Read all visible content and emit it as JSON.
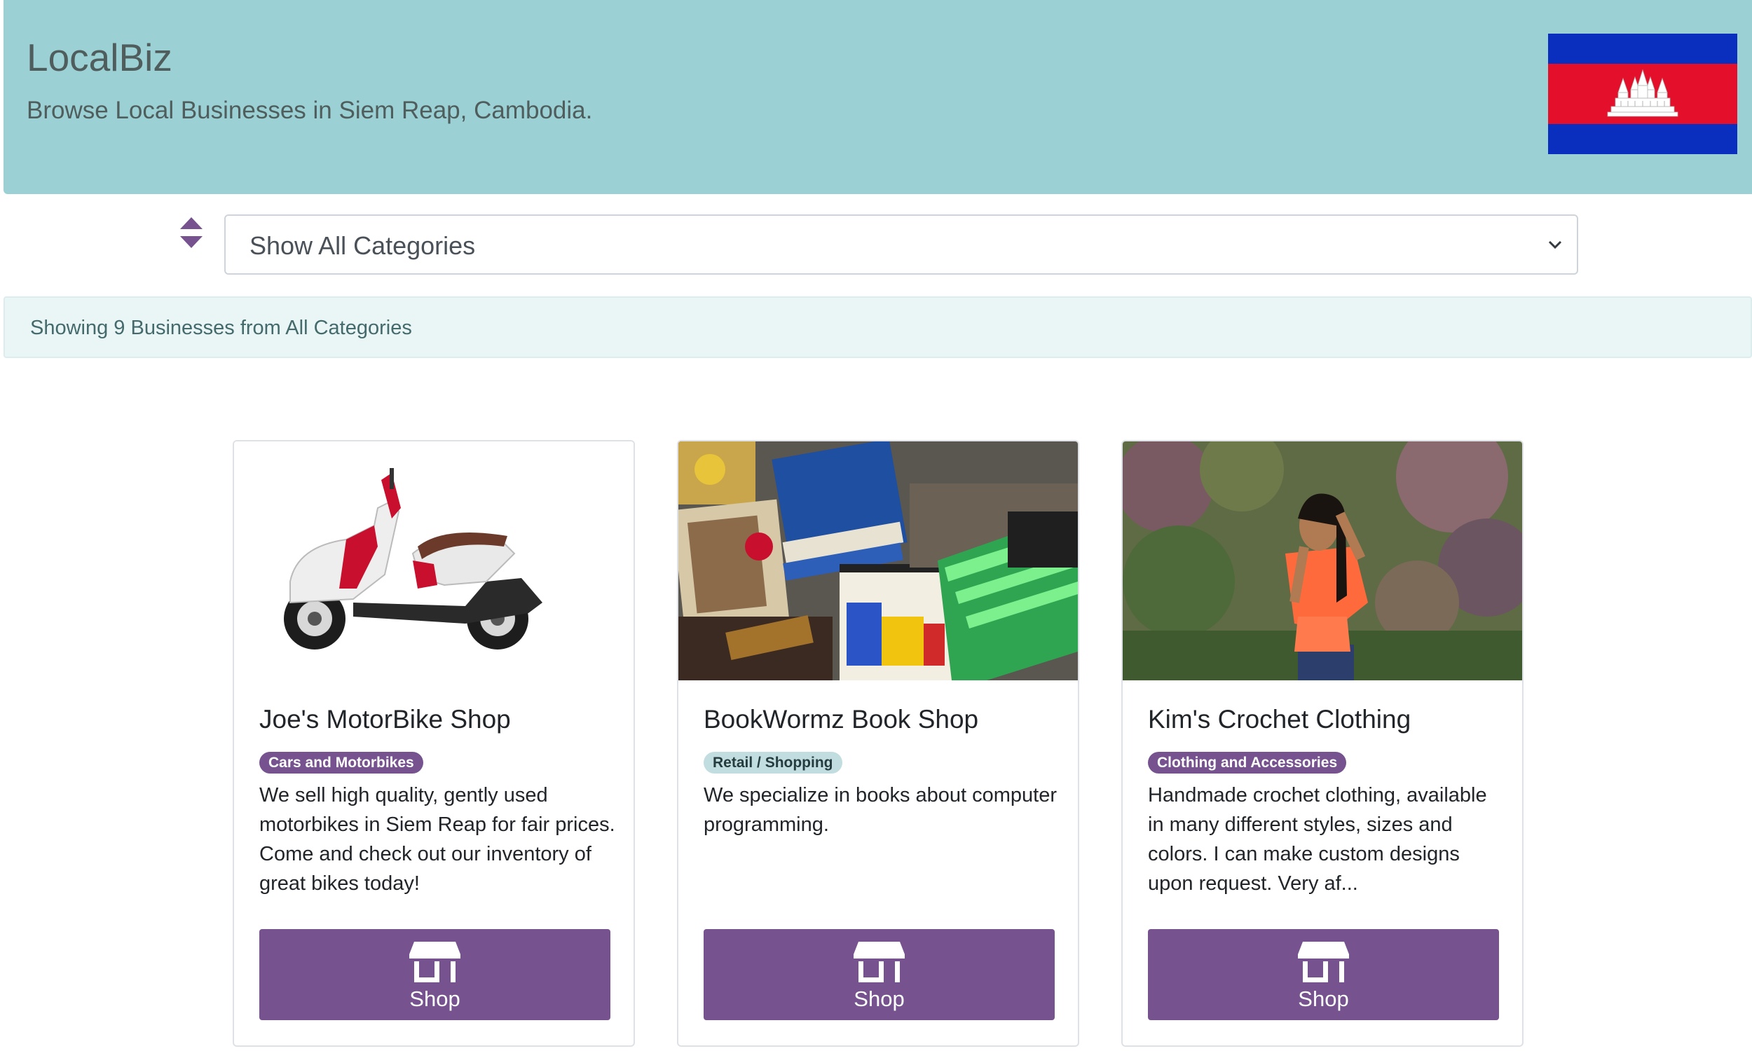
{
  "header": {
    "brand": "LocalBiz",
    "tagline": "Browse Local Businesses in Siem Reap, Cambodia."
  },
  "filter": {
    "selected": "Show All Categories"
  },
  "info": {
    "text": "Showing 9 Businesses from All Categories"
  },
  "cards": [
    {
      "title": "Joe's MotorBike Shop",
      "category": "Cars and Motorbikes",
      "description": "We sell high quality, gently used motorbikes in Siem Reap for fair prices. Come and check out our inventory of great bikes today!",
      "button": "Shop",
      "image": "motorbike photo"
    },
    {
      "title": "BookWormz Book Shop",
      "category": "Retail / Shopping",
      "description": "We specialize in books about computer programming.",
      "button": "Shop",
      "image": "books photo"
    },
    {
      "title": "Kim's Crochet Clothing",
      "category": "Clothing and Accessories",
      "description": "Handmade crochet clothing, available in many different styles, sizes and colors. I can make custom designs upon request. Very af...",
      "button": "Shop",
      "image": "woman in crochet top photo"
    }
  ],
  "colors": {
    "header_bg": "#9bd1d5",
    "accent_purple": "#76528f",
    "info_bg": "#eaf5f6"
  }
}
